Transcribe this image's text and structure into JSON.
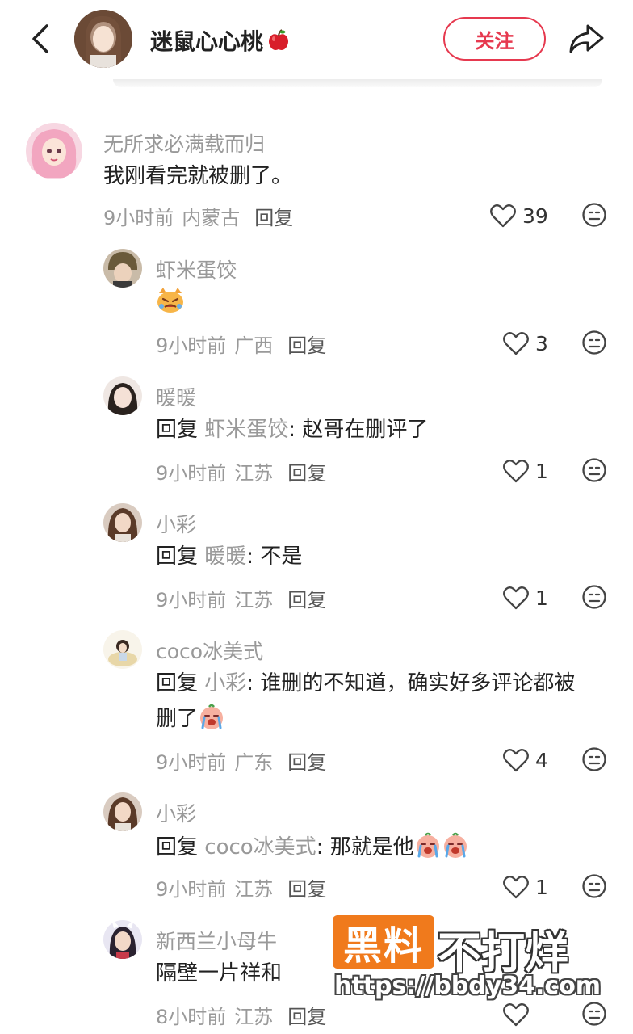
{
  "header": {
    "author_name": "迷鼠心心桃",
    "follow_label": "关注"
  },
  "comments": [
    {
      "username": "无所求必满载而归",
      "text": "我刚看完就被删了。",
      "time": "9小时前",
      "location": "内蒙古",
      "reply_label": "回复",
      "likes": "39"
    },
    {
      "username": "虾米蛋饺",
      "time": "9小时前",
      "location": "广西",
      "reply_label": "回复",
      "likes": "3"
    },
    {
      "username": "暖暖",
      "reply_prefix": "回复",
      "reply_to": "虾米蛋饺",
      "text": ": 赵哥在删评了",
      "time": "9小时前",
      "location": "江苏",
      "reply_label": "回复",
      "likes": "1"
    },
    {
      "username": "小彩",
      "reply_prefix": "回复",
      "reply_to": "暖暖",
      "text": ": 不是",
      "time": "9小时前",
      "location": "江苏",
      "reply_label": "回复",
      "likes": "1"
    },
    {
      "username": "coco冰美式",
      "reply_prefix": "回复",
      "reply_to": "小彩",
      "text": ": 谁删的不知道，确实好多评论都被",
      "text_line2": "删了",
      "time": "9小时前",
      "location": "广东",
      "reply_label": "回复",
      "likes": "4"
    },
    {
      "username": "小彩",
      "reply_prefix": "回复",
      "reply_to": "coco冰美式",
      "text": ": 那就是他",
      "time": "9小时前",
      "location": "江苏",
      "reply_label": "回复",
      "likes": "1"
    },
    {
      "username": "新西兰小母牛",
      "text": "隔壁一片祥和",
      "time": "8小时前",
      "location": "江苏",
      "reply_label": "回复"
    }
  ],
  "watermark": {
    "box_text": "黑料",
    "main_text": "不打烊",
    "url": "https://bbdy34.com"
  },
  "colors": {
    "accent": "#e6394f",
    "watermark_orange": "#f07a1c",
    "meta_gray": "#999999"
  }
}
